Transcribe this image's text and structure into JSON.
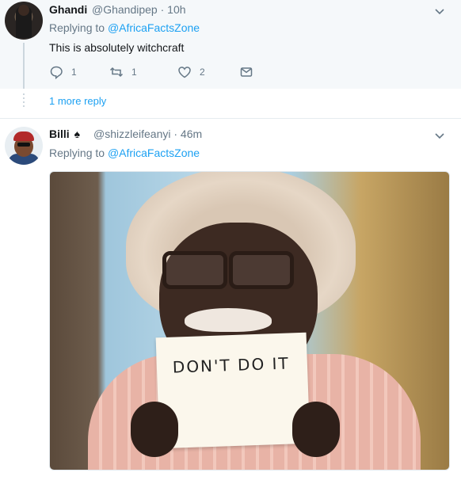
{
  "tweet1": {
    "name": "Ghandi",
    "handle": "@Ghandipep",
    "time": "· 10h",
    "replying_prefix": "Replying to",
    "replying_to": "@AfricaFactsZone",
    "text": "This is absolutely witchcraft",
    "replies": "1",
    "retweets": "1",
    "likes": "2"
  },
  "more_replies": "1 more reply",
  "tweet2": {
    "name": "Billi",
    "emoji": "♠",
    "handle": "@shizzleifeanyi",
    "time": "· 46m",
    "replying_prefix": "Replying to",
    "replying_to": "@AfricaFactsZone",
    "media_sign_text": "DON'T DO IT"
  },
  "colors": {
    "link": "#1da1f2",
    "muted": "#657786",
    "text": "#14171a",
    "highlight_bg": "#f5f8fa"
  },
  "icons": [
    "reply-icon",
    "retweet-icon",
    "like-icon",
    "message-icon",
    "chevron-down-icon"
  ]
}
